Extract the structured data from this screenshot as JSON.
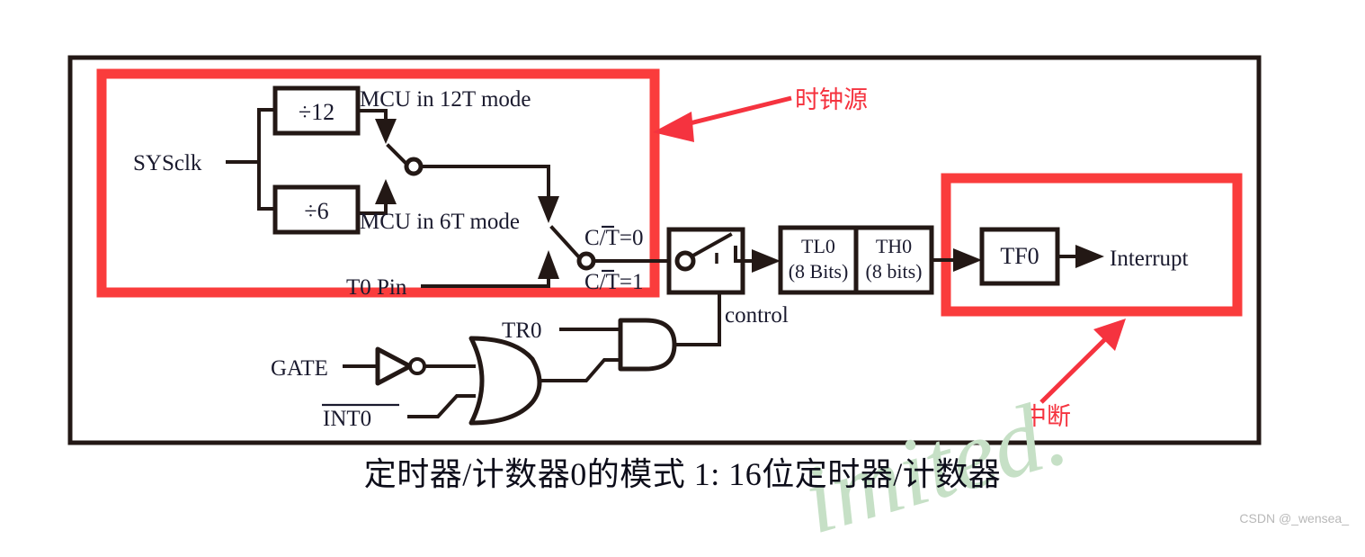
{
  "figure": {
    "caption": "定时器/计数器0的模式 1: 16位定时器/计数器",
    "watermark_green": "imited.",
    "watermark_credit": "CSDN @_wensea_"
  },
  "colors": {
    "highlight_red": "#fa3c3c",
    "annotation_red": "#f5333f",
    "ink": "#231815",
    "text": "#1a1a2e",
    "watermark_green": "#c6e0c6",
    "watermark_gray": "#b8b8b8",
    "background": "#ffffff"
  },
  "annotations": [
    {
      "id": "clock-source",
      "label": "时钟源",
      "points_to": "clock-source-red-box"
    },
    {
      "id": "interrupt",
      "label": "中断",
      "points_to": "interrupt-red-box"
    }
  ],
  "signals": {
    "sysclk": "SYSclk",
    "t0_pin": "T0 Pin",
    "tr0": "TR0",
    "gate": "GATE",
    "int0": "INT0",
    "int0_overline": true,
    "control": "control",
    "interrupt_out": "Interrupt"
  },
  "blocks": [
    {
      "id": "div12",
      "label": "÷12"
    },
    {
      "id": "div6",
      "label": "÷6"
    },
    {
      "id": "tl0",
      "label_top": "TL0",
      "label_bottom": "(8 Bits)"
    },
    {
      "id": "th0",
      "label_top": "TH0",
      "label_bottom": "(8 bits)"
    },
    {
      "id": "tf0",
      "label": "TF0"
    }
  ],
  "mode_labels": {
    "mode_12t": "MCU in 12T mode",
    "mode_6t": "MCU in 6T mode"
  },
  "switch_labels": {
    "ct_zero_prefix": "C/",
    "ct_zero_t": "T",
    "ct_zero_suffix": "=0",
    "ct_one_prefix": "C/",
    "ct_one_t": "T",
    "ct_one_suffix": "=1",
    "ct_zero_full": "C/T=0",
    "ct_one_full": "C/T=1"
  },
  "logic_gates": [
    {
      "id": "not-gate",
      "type": "NOT",
      "inputs": [
        "GATE"
      ]
    },
    {
      "id": "or-gate",
      "type": "OR",
      "inputs": [
        "NOT(GATE)",
        "INT0"
      ]
    },
    {
      "id": "and-gate",
      "type": "AND",
      "inputs": [
        "TR0",
        "OR-output"
      ]
    }
  ],
  "regions": [
    {
      "id": "clock-source-red-box",
      "label": "时钟源"
    },
    {
      "id": "interrupt-red-box",
      "label": "中断"
    }
  ]
}
